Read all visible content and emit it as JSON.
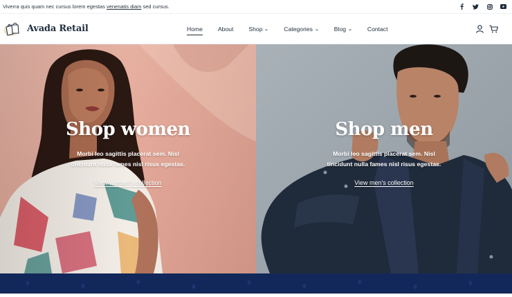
{
  "topbar": {
    "text_before": "Viverra quis quam nec cursus lorem egestas ",
    "link": "venenatis diam",
    "text_after": " sed cursus.",
    "social_icons": [
      "facebook-icon",
      "twitter-icon",
      "instagram-icon",
      "youtube-icon"
    ]
  },
  "header": {
    "brand": "Avada Retail",
    "nav": [
      {
        "label": "Home",
        "active": true
      },
      {
        "label": "About"
      },
      {
        "label": "Shop",
        "dropdown": true
      },
      {
        "label": "Categories",
        "dropdown": true
      },
      {
        "label": "Blog",
        "dropdown": true
      },
      {
        "label": "Contact"
      }
    ],
    "icons": [
      "user-icon",
      "cart-icon"
    ]
  },
  "hero": {
    "women": {
      "title": "Shop women",
      "description": "Morbi leo sagittis placerat sem. Nisl tincidunt nulla fames nisl risus egestas.",
      "link": "View women's collection"
    },
    "men": {
      "title": "Shop men",
      "description": "Morbi leo sagittis placerat sem. Nisl tincidunt nulla fames nisl risus egestas.",
      "link": "View men's collection"
    }
  },
  "colors": {
    "brand_text": "#1f2d3d",
    "band": "#13285a",
    "women_bg": "#e8b1a4",
    "men_bg": "#a4adb5"
  }
}
